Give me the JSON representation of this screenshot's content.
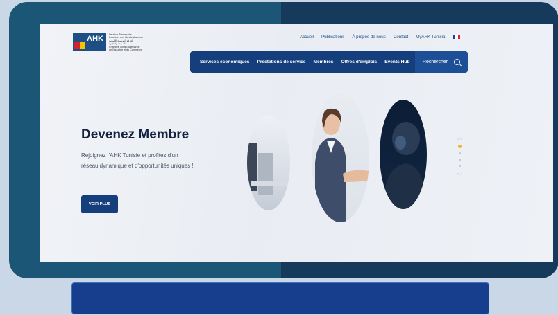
{
  "logo": {
    "mark": "AHK",
    "lines": [
      "Deutsch-Tunesische",
      "Industrie- und Handelskammer",
      "الغرفة التونسية الألمانية",
      "للصناعة والتجارة",
      "Chambre Tuniso-Allemande",
      "de l'Industrie et du Commerce"
    ]
  },
  "topnav": {
    "links": [
      "Accueil",
      "Publications",
      "À propos de nous",
      "Contact",
      "MyAHK Tunisia"
    ],
    "language_flag": "fr-flag-icon"
  },
  "mainnav": {
    "items": [
      "Services économiques",
      "Prestations de service",
      "Membres",
      "Offres d'emplois",
      "Events Hub"
    ],
    "search_label": "Rechercher"
  },
  "hero": {
    "title": "Devenez Membre",
    "text": "Rejoignez l'AHK Tunisie et profitez d'un réseau dynamique et d'opportunités uniques !",
    "button": "VOIR PLUS"
  },
  "slider": {
    "count": 4,
    "active": 1
  },
  "colors": {
    "navy": "#143f7c",
    "accent": "#f0b323",
    "frame_left": "#1c5676",
    "frame_right": "#153a5c",
    "caption_bar": "#163e8c"
  }
}
